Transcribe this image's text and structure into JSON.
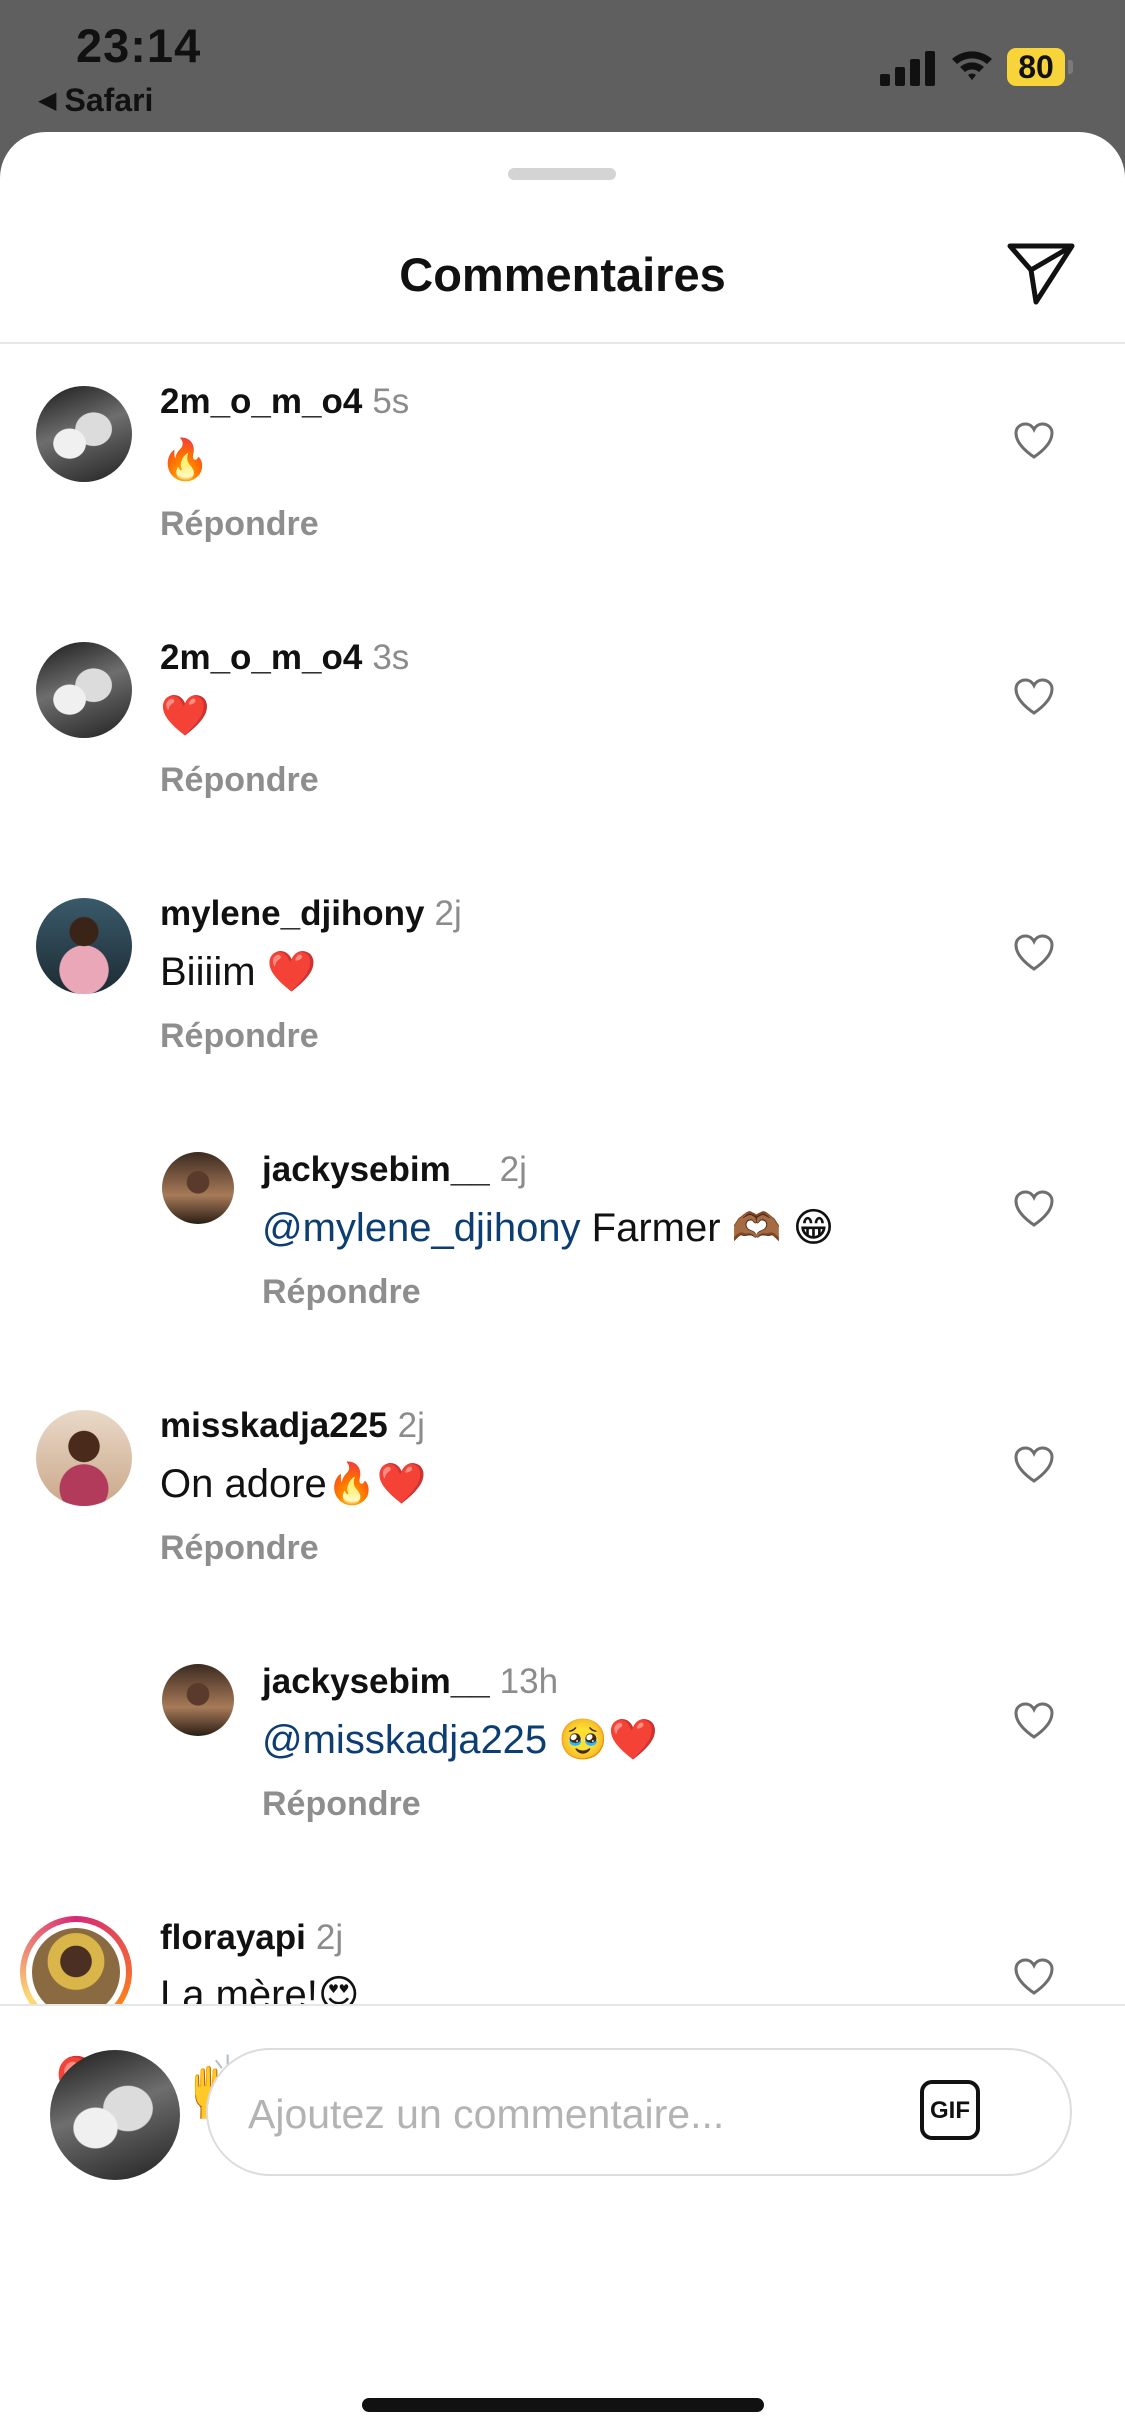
{
  "status_bar": {
    "time": "23:14",
    "back_app": "Safari",
    "battery": "80"
  },
  "header": {
    "title": "Commentaires",
    "send_icon": "paper-plane-icon"
  },
  "comments": [
    {
      "username": "2m_o_m_o4",
      "time": "5s",
      "text": "🔥",
      "reply_label": "Répondre"
    },
    {
      "username": "2m_o_m_o4",
      "time": "3s",
      "text": "❤️",
      "reply_label": "Répondre"
    },
    {
      "username": "mylene_djihony",
      "time": "2j",
      "text": "Biiiim ❤️",
      "reply_label": "Répondre"
    },
    {
      "username": "jackysebim__",
      "time": "2j",
      "mention": "@mylene_djihony",
      "text": " Farmer 🫶🏾 😁",
      "reply_label": "Répondre"
    },
    {
      "username": "misskadja225",
      "time": "2j",
      "text": "On adore🔥❤️",
      "reply_label": "Répondre"
    },
    {
      "username": "jackysebim__",
      "time": "13h",
      "mention": "@misskadja225",
      "text": " 🥹❤️",
      "reply_label": "Répondre"
    },
    {
      "username": "florayapi",
      "time": "2j",
      "text": "La mère!😍"
    }
  ],
  "quick_emojis": [
    "❤️",
    "🙌",
    "🔥",
    "👏",
    "😢",
    "😍",
    "😮",
    "😂"
  ],
  "input": {
    "placeholder": "Ajoutez un commentaire...",
    "gif_label": "GIF"
  },
  "colors": {
    "mention": "#0c3e73",
    "muted": "#8e8e8e",
    "battery": "#f7d43a"
  }
}
